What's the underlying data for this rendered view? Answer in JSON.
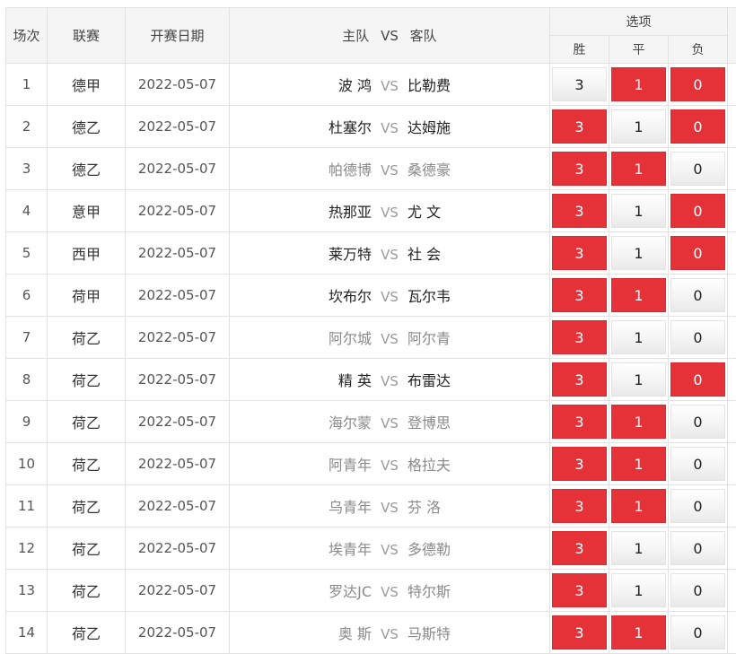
{
  "header": {
    "no": "场次",
    "league": "联赛",
    "date": "开赛日期",
    "home": "主队",
    "vs": "VS",
    "away": "客队",
    "options": "选项",
    "win": "胜",
    "draw": "平",
    "lose": "负"
  },
  "colors": {
    "selected": "#e53238",
    "unselected": "#f3f3f3"
  },
  "rows": [
    {
      "no": "1",
      "league": "德甲",
      "date": "2022-05-07",
      "home": "波 鸿",
      "away": "比勒费",
      "tone": "dark",
      "win": "3",
      "draw": "1",
      "lose": "0",
      "sel": [
        false,
        true,
        true
      ]
    },
    {
      "no": "2",
      "league": "德乙",
      "date": "2022-05-07",
      "home": "杜塞尔",
      "away": "达姆施",
      "tone": "dark",
      "win": "3",
      "draw": "1",
      "lose": "0",
      "sel": [
        true,
        false,
        true
      ]
    },
    {
      "no": "3",
      "league": "德乙",
      "date": "2022-05-07",
      "home": "帕德博",
      "away": "桑德豪",
      "tone": "grey",
      "win": "3",
      "draw": "1",
      "lose": "0",
      "sel": [
        true,
        true,
        false
      ]
    },
    {
      "no": "4",
      "league": "意甲",
      "date": "2022-05-07",
      "home": "热那亚",
      "away": "尤 文",
      "tone": "dark",
      "win": "3",
      "draw": "1",
      "lose": "0",
      "sel": [
        true,
        false,
        true
      ]
    },
    {
      "no": "5",
      "league": "西甲",
      "date": "2022-05-07",
      "home": "莱万特",
      "away": "社 会",
      "tone": "dark",
      "win": "3",
      "draw": "1",
      "lose": "0",
      "sel": [
        true,
        false,
        true
      ]
    },
    {
      "no": "6",
      "league": "荷甲",
      "date": "2022-05-07",
      "home": "坎布尔",
      "away": "瓦尔韦",
      "tone": "dark",
      "win": "3",
      "draw": "1",
      "lose": "0",
      "sel": [
        true,
        true,
        false
      ]
    },
    {
      "no": "7",
      "league": "荷乙",
      "date": "2022-05-07",
      "home": "阿尔城",
      "away": "阿尔青",
      "tone": "grey",
      "win": "3",
      "draw": "1",
      "lose": "0",
      "sel": [
        true,
        false,
        false
      ]
    },
    {
      "no": "8",
      "league": "荷乙",
      "date": "2022-05-07",
      "home": "精 英",
      "away": "布雷达",
      "tone": "dark",
      "win": "3",
      "draw": "1",
      "lose": "0",
      "sel": [
        true,
        false,
        true
      ]
    },
    {
      "no": "9",
      "league": "荷乙",
      "date": "2022-05-07",
      "home": "海尔蒙",
      "away": "登博思",
      "tone": "grey",
      "win": "3",
      "draw": "1",
      "lose": "0",
      "sel": [
        true,
        true,
        false
      ]
    },
    {
      "no": "10",
      "league": "荷乙",
      "date": "2022-05-07",
      "home": "阿青年",
      "away": "格拉夫",
      "tone": "grey",
      "win": "3",
      "draw": "1",
      "lose": "0",
      "sel": [
        true,
        true,
        false
      ]
    },
    {
      "no": "11",
      "league": "荷乙",
      "date": "2022-05-07",
      "home": "乌青年",
      "away": "芬 洛",
      "tone": "grey",
      "win": "3",
      "draw": "1",
      "lose": "0",
      "sel": [
        true,
        true,
        false
      ]
    },
    {
      "no": "12",
      "league": "荷乙",
      "date": "2022-05-07",
      "home": "埃青年",
      "away": "多德勒",
      "tone": "grey",
      "win": "3",
      "draw": "1",
      "lose": "0",
      "sel": [
        true,
        false,
        false
      ]
    },
    {
      "no": "13",
      "league": "荷乙",
      "date": "2022-05-07",
      "home": "罗达JC",
      "away": "特尔斯",
      "tone": "grey",
      "win": "3",
      "draw": "1",
      "lose": "0",
      "sel": [
        true,
        false,
        false
      ]
    },
    {
      "no": "14",
      "league": "荷乙",
      "date": "2022-05-07",
      "home": "奥 斯",
      "away": "马斯特",
      "tone": "grey",
      "win": "3",
      "draw": "1",
      "lose": "0",
      "sel": [
        true,
        true,
        false
      ]
    }
  ]
}
